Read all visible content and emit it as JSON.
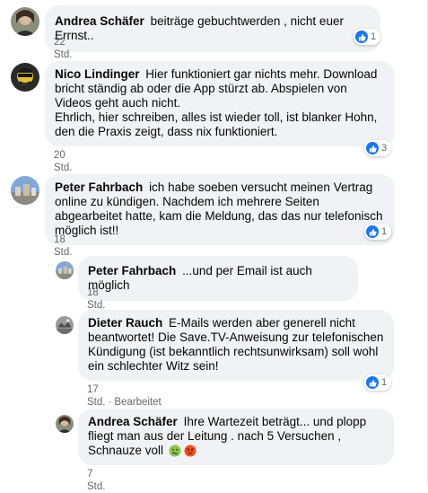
{
  "comments": [
    {
      "author": "Andrea Schäfer",
      "text": "beiträge gebuchtwerden , nicht euer Errnst..",
      "time": "22 Std.",
      "reaction_count": "1",
      "reaction_icon": "like-icon"
    },
    {
      "author": "Nico Lindinger",
      "text_1": "Hier funktioniert gar nichts mehr. Download bricht ständig ab oder die App stürzt ab. Abspielen von Videos geht auch nicht.",
      "text_2": "Ehrlich, hier schreiben, alles ist wieder toll, ist blanker Hohn, den die Praxis zeigt, dass nix funktioniert.",
      "time": "20 Std.",
      "reaction_count": "3",
      "reaction_icon": "like-icon"
    },
    {
      "author": "Peter Fahrbach",
      "text": "ich habe soeben versucht meinen Vertrag online zu kündigen. Nachdem ich mehrere Seiten abgearbeitet hatte, kam die Meldung, das das nur telefonisch möglich ist!!",
      "time": "18 Std.",
      "reaction_count": "1",
      "reaction_icon": "like-icon"
    },
    {
      "author": "Peter Fahrbach",
      "text": "...und per Email ist auch möglich",
      "time": "18 Std."
    },
    {
      "author": "Dieter Rauch",
      "text": "E-Mails werden aber generell nicht beantwortet! Die Save.TV-Anweisung zur telefonischen Kündigung (ist bekanntlich rechtsunwirksam) soll wohl ein schlechter Witz sein!",
      "time": "17 Std.",
      "edited_label": "Bearbeitet",
      "reaction_count": "1",
      "reaction_icon": "like-icon"
    },
    {
      "author": "Andrea Schäfer",
      "text": "Ihre Wartezeit beträgt... und plopp fliegt man aus der Leitung . nach 5 Versuchen , Schnauze voll",
      "emojis": [
        "nauseated-face-icon",
        "angry-face-icon"
      ],
      "time": "7 Std."
    }
  ],
  "colors": {
    "bubble": "#f0f2f5",
    "like_blue": "#1877f2",
    "meta_gray": "#65676b",
    "text": "#050505"
  }
}
